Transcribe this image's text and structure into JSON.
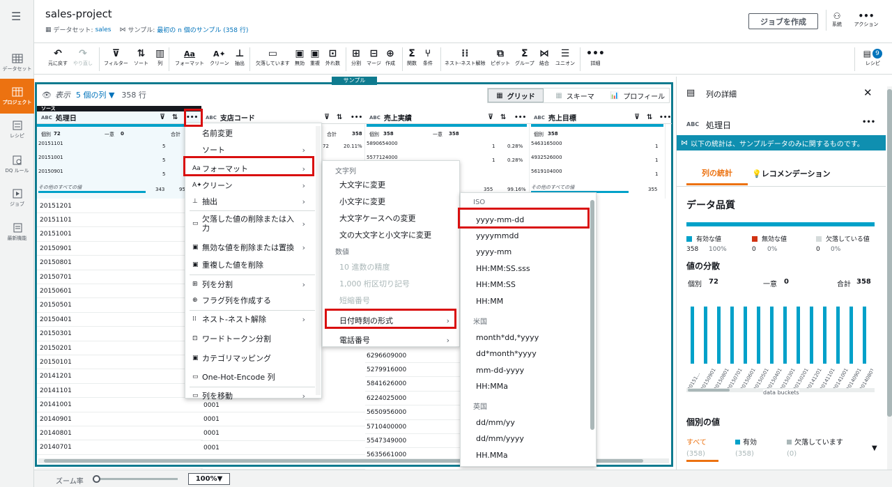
{
  "nav": [
    {
      "label": "データセット",
      "icon": "table-icon"
    },
    {
      "label": "プロジェクト",
      "icon": "project-icon"
    },
    {
      "label": "レシピ",
      "icon": "list-icon"
    },
    {
      "label": "DQ ルール",
      "icon": "dq-rule-icon"
    },
    {
      "label": "ジョブ",
      "icon": "play-icon"
    },
    {
      "label": "最新機能",
      "icon": "news-icon"
    }
  ],
  "header": {
    "title": "sales-project",
    "dataset_label": "データセット:",
    "dataset": "sales",
    "sample_label": "サンプル:",
    "sample": "最初の n 個のサンプル (358 行)",
    "job_button": "ジョブを作成",
    "lineage": "系統",
    "actions": "アクション"
  },
  "toolbar": {
    "items": [
      "元に戻す",
      "やり直し",
      "フィルター",
      "ソート",
      "列",
      "フォーマット",
      "クリーン",
      "抽出",
      "欠落しています",
      "無効",
      "重複",
      "外れ数",
      "分割",
      "マージ",
      "作成",
      "関数",
      "条件",
      "ネスト-ネスト解除",
      "ピボット",
      "グループ",
      "結合",
      "ユニオン",
      "詳細"
    ],
    "recipe": "レシピ",
    "recipe_count": "9"
  },
  "sample_tag": "サンプル",
  "view": {
    "label": "表示",
    "cols": "5 個の列 ▼",
    "rows": "358 行",
    "tab_grid": "グリッド",
    "tab_schema": "スキーマ",
    "tab_profile": "プロフィール"
  },
  "source_label": "ソース",
  "columns": [
    {
      "name": "処理日"
    },
    {
      "name": "支店コード"
    },
    {
      "name": "売上実績"
    },
    {
      "name": "売上目標"
    }
  ],
  "stats": {
    "distinct": "個別",
    "distinct_v": "72",
    "unique": "一意",
    "unique_v": "0",
    "total": "合計",
    "total_v": "358",
    "other": "その他のすべての値",
    "c1": [
      {
        "v": "20151101",
        "n": "5"
      },
      {
        "v": "20151001",
        "n": "5"
      },
      {
        "v": "20150901",
        "n": "5"
      }
    ],
    "c1_rest": "343",
    "c1_pct": "95",
    "c2_pct": "20.11%",
    "c2_n": "72",
    "c3": [
      {
        "v": "5890654000",
        "n": "1",
        "p": "0.28%"
      },
      {
        "v": "5577124000",
        "n": "1",
        "p": "0.28%"
      }
    ],
    "c3_rest": "355",
    "c3_pct": "99.16%",
    "c4": [
      {
        "v": "5463165000",
        "n": "1"
      },
      {
        "v": "4932526000",
        "n": "1"
      },
      {
        "v": "5619104000",
        "n": "1"
      }
    ],
    "c4_rest": "355"
  },
  "rows_c1": [
    "20151201",
    "20151101",
    "20151001",
    "20150901",
    "20150801",
    "20150701",
    "20150601",
    "20150501",
    "20150401",
    "20150301",
    "20150201",
    "20150101",
    "20141201",
    "20141101",
    "20141001",
    "20140901",
    "20140801",
    "20140701",
    "20140601"
  ],
  "rows_c2": [
    "0001",
    "0001",
    "0001",
    "0001",
    "0001"
  ],
  "rows_c3": [
    "6296609000",
    "5279916000",
    "5841626000",
    "6224025000",
    "5650956000",
    "5710400000",
    "5547349000",
    "5635661000"
  ],
  "menu1": [
    "名前変更",
    "ソート",
    "フォーマット",
    "クリーン",
    "抽出",
    "欠落した値の削除または入力",
    "無効な値を削除または置換",
    "重複した値を削除",
    "列を分割",
    "フラグ列を作成する",
    "ネスト-ネスト解除",
    "ワードトークン分割",
    "カテゴリマッピング",
    "One-Hot-Encode 列",
    "列を移動"
  ],
  "menu2": {
    "g1": "文字列",
    "items1": [
      "大文字に変更",
      "小文字に変更",
      "大文字ケースへの変更",
      "文の大文字と小文字に変更"
    ],
    "g2": "数値",
    "items2": [
      "10 進数の精度",
      "1,000 桁区切り記号",
      "短縮番号"
    ],
    "items3": [
      "日付時刻の形式",
      "電話番号"
    ]
  },
  "menu3": {
    "g1": "ISO",
    "iso": [
      "yyyy-mm-dd",
      "yyyymmdd",
      "yyyy-mm",
      "HH:MM:SS.sss",
      "HH:MM:SS",
      "HH:MM"
    ],
    "g2": "米国",
    "us": [
      "month*dd,*yyyy",
      "dd*month*yyyy",
      "mm-dd-yyyy",
      "HH:MMa"
    ],
    "g3": "英国",
    "uk": [
      "dd/mm/yy",
      "dd/mm/yyyy",
      "HH.MMa"
    ]
  },
  "panel": {
    "title": "列の詳細",
    "col_type": "ABC",
    "col_name": "処理日",
    "notice": "以下の統計は、サンプルデータのみに関するものです。",
    "tab1": "列の統計",
    "tab2": "レコメンデーション",
    "dq": "データ品質",
    "valid": "有効な値",
    "valid_n": "358",
    "valid_p": "100%",
    "invalid": "無効な値",
    "invalid_n": "0",
    "invalid_p": "0%",
    "missing": "欠落している値",
    "missing_n": "0",
    "missing_p": "0%",
    "dist": "値の分散",
    "distinct": "個別",
    "distinct_v": "72",
    "unique": "一意",
    "unique_v": "0",
    "total": "合計",
    "total_v": "358",
    "xlabels": [
      "20151...",
      "20150901",
      "20150801",
      "20150701",
      "20150601",
      "20150501",
      "20150401",
      "20150301",
      "20150201",
      "20141201",
      "20141101",
      "20141001",
      "20140901",
      "20140801"
    ],
    "buckets": "data buckets",
    "individual": "個別の値",
    "f_all": "すべて",
    "f_all_n": "(358)",
    "f_valid": "有効",
    "f_valid_n": "(358)",
    "f_missing": "欠落しています",
    "f_missing_n": "(0)"
  },
  "chart_data": {
    "type": "bar",
    "values": [
      5,
      5,
      5,
      5,
      5,
      5,
      5,
      5,
      5,
      5,
      5,
      5,
      5,
      5,
      5,
      5,
      5,
      5,
      5,
      5,
      5,
      5,
      5,
      5,
      5,
      5,
      5,
      5,
      5,
      5,
      5,
      5,
      5,
      5,
      5,
      5,
      5,
      5,
      5,
      5,
      5,
      5,
      5,
      5,
      5,
      5,
      5,
      5,
      5,
      5,
      5,
      5,
      5,
      5,
      5,
      5,
      5,
      5,
      5,
      5,
      5,
      5,
      5,
      5,
      5,
      5,
      5,
      5,
      5,
      5,
      5,
      5
    ],
    "xlabel": "data buckets"
  },
  "footer": {
    "zoom": "ズーム率",
    "zoom_v": "100%▼"
  },
  "colors": {
    "accent": "#ec7211",
    "teal": "#0f7b8f",
    "highlight": "#d90f0f",
    "bar": "#00a1c9"
  }
}
